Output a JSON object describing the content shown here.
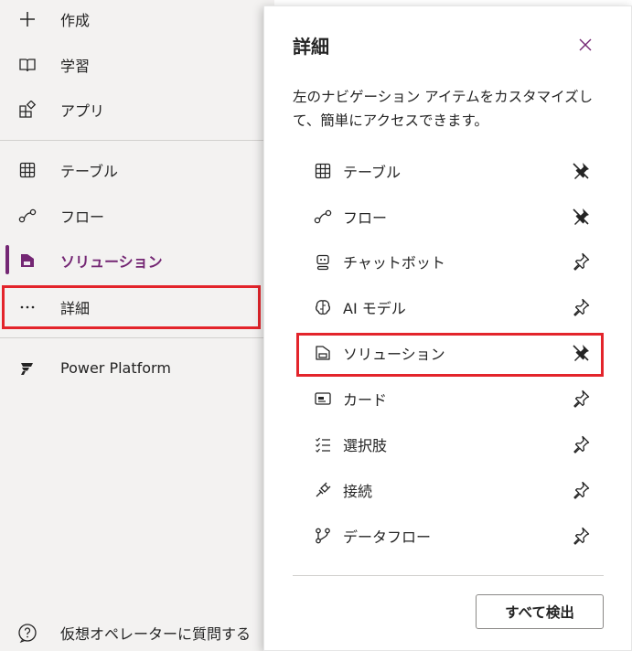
{
  "nav": {
    "items": [
      {
        "label": "作成",
        "icon": "plus-icon"
      },
      {
        "label": "学習",
        "icon": "book-icon"
      },
      {
        "label": "アプリ",
        "icon": "apps-icon"
      },
      {
        "label": "テーブル",
        "icon": "table-icon"
      },
      {
        "label": "フロー",
        "icon": "flow-icon"
      },
      {
        "label": "ソリューション",
        "icon": "solution-icon",
        "active": true
      },
      {
        "label": "詳細",
        "icon": "more-icon",
        "highlighted": true
      },
      {
        "label": "Power Platform",
        "icon": "power-platform-icon"
      }
    ],
    "virtual_agent_label": "仮想オペレーターに質問する"
  },
  "panel": {
    "title": "詳細",
    "description": "左のナビゲーション アイテムをカスタマイズして、簡単にアクセスできます。",
    "items": [
      {
        "label": "テーブル",
        "icon": "table-icon",
        "pinned": true
      },
      {
        "label": "フロー",
        "icon": "flow-icon",
        "pinned": true
      },
      {
        "label": "チャットボット",
        "icon": "bot-icon",
        "pinned": false
      },
      {
        "label": "AI モデル",
        "icon": "brain-icon",
        "pinned": false
      },
      {
        "label": "ソリューション",
        "icon": "solution-icon",
        "pinned": true,
        "highlighted": true
      },
      {
        "label": "カード",
        "icon": "card-icon",
        "pinned": false
      },
      {
        "label": "選択肢",
        "icon": "choice-list-icon",
        "pinned": false
      },
      {
        "label": "接続",
        "icon": "plug-icon",
        "pinned": false
      },
      {
        "label": "データフロー",
        "icon": "dataflow-icon",
        "pinned": false
      }
    ],
    "detect_all_label": "すべて検出"
  },
  "colors": {
    "accent": "#742774",
    "highlight": "#e3242b",
    "nav_bg": "#f3f2f1"
  }
}
